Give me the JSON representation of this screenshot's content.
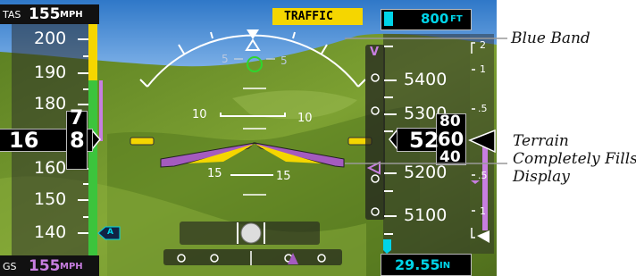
{
  "tas": {
    "label": "TAS",
    "value": "155",
    "unit": "MPH"
  },
  "gs": {
    "label": "GS",
    "value": "155",
    "unit": "MPH"
  },
  "traffic_annunciation": "TRAFFIC",
  "selected_altitude": {
    "value": "800",
    "unit": "FT"
  },
  "baro_setting": {
    "value": "29.55",
    "unit": "IN"
  },
  "airspeed_tape": {
    "ticks": [
      "200",
      "190",
      "180",
      "160",
      "150",
      "140"
    ],
    "current": {
      "hundreds_tens": "16",
      "ones_top": "7",
      "ones_mid": "8"
    },
    "ref_marker": "A"
  },
  "altitude_tape": {
    "ticks": [
      "5400",
      "5300",
      "5200",
      "5100"
    ],
    "current": {
      "major": "52",
      "minor_top": "80",
      "minor_mid": "60",
      "minor_bottom": "40"
    },
    "vnav_marker": "V"
  },
  "vsi_scale": [
    "2",
    "1",
    ".5",
    ".5",
    "1"
  ],
  "pitch_labels": {
    "p10": "10",
    "p15": "15",
    "p5": "5"
  },
  "callouts": {
    "blue_band": "Blue Band",
    "terrain": [
      "Terrain",
      "Completely Fills",
      "Display"
    ]
  },
  "colors": {
    "sky": "#3d8fd9",
    "terrain": "#6b8e23",
    "aircraft_symbol": "#a45bbf",
    "amber": "#f5d600",
    "magenta": "#c77ee0",
    "cyan": "#00d4e8",
    "airspeed_green": "#3cc43c"
  }
}
